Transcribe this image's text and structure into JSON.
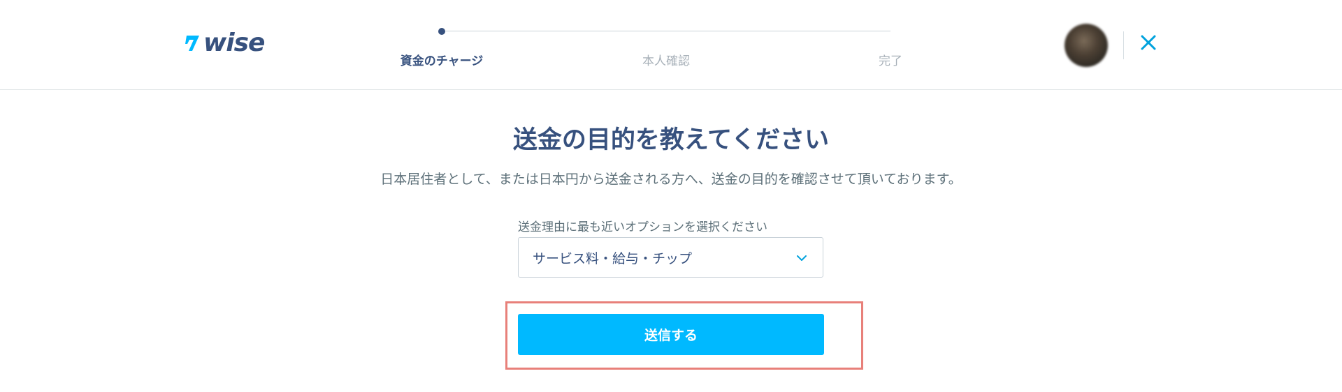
{
  "header": {
    "logo_text": "wise",
    "steps": [
      {
        "label": "資金のチャージ",
        "state": "active"
      },
      {
        "label": "本人確認",
        "state": "inactive"
      },
      {
        "label": "完了",
        "state": "inactive"
      }
    ],
    "close_icon": "close-icon",
    "avatar_icon": "avatar"
  },
  "main": {
    "title": "送金の目的を教えてください",
    "subtitle": "日本居住者として、または日本円から送金される方へ、送金の目的を確認させて頂いております。",
    "purpose_select": {
      "label": "送金理由に最も近いオプションを選択ください",
      "selected_value": "サービス料・給与・チップ",
      "icon": "chevron-down-icon"
    },
    "submit_label": "送信する"
  },
  "colors": {
    "brand_navy": "#37517e",
    "accent_blue": "#00b9ff",
    "highlight_red": "#e8807a",
    "close_teal": "#00a2dd"
  }
}
